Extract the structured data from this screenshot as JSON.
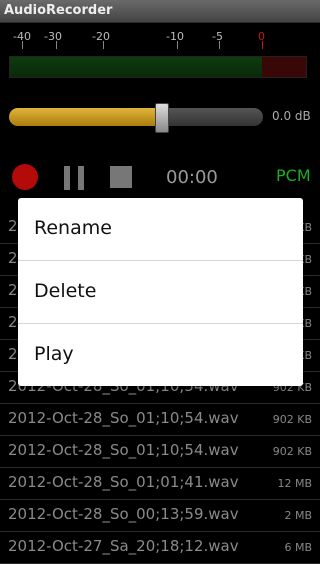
{
  "app": {
    "title": "AudioRecorder"
  },
  "meter": {
    "scale_labels": [
      "-40",
      "-30",
      "-20",
      "-10",
      "-5",
      "0"
    ],
    "clip_color": "#c31a1a",
    "level_color": "#1e6a1e"
  },
  "gain": {
    "value_label": "0.0 dB",
    "level_fraction": 0.6
  },
  "controls": {
    "time": "00:00",
    "format": "PCM"
  },
  "context_menu": {
    "items": [
      "Rename",
      "Delete",
      "Play"
    ]
  },
  "recordings": [
    {
      "name": "2012-Oct-28_So_01;10;54.wav",
      "size": "902 KB"
    },
    {
      "name": "2012-Oct-28_So_01;01;41.wav",
      "size": "12 MB"
    },
    {
      "name": "2012-Oct-28_So_00;13;59.wav",
      "size": "2 MB"
    },
    {
      "name": "2012-Oct-27_Sa_20;18;12.wav",
      "size": "6 MB"
    }
  ]
}
